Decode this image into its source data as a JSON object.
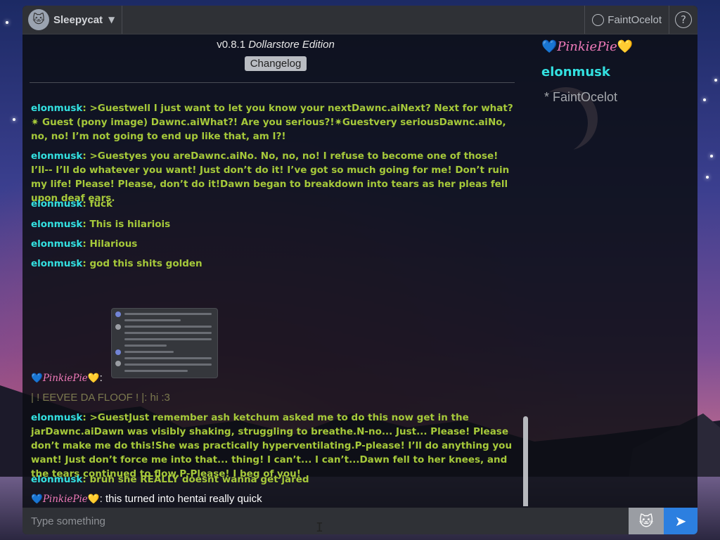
{
  "topbar": {
    "room_name": "Sleepycat",
    "username": "FaintOcelot",
    "help_label": "?"
  },
  "header": {
    "version": "v0.8.1",
    "edition": "Dollarstore Edition",
    "changelog_label": "Changelog"
  },
  "messages": [
    {
      "nick": "elonmusk",
      "text": ": >Guestwell I just want to let you know your nextDawnc.aiNext? Next for what?✷ Guest (pony image) Dawnc.aiWhat?! Are you serious?!✷Guestvery seriousDawnc.aiNo, no, no! I’m not going to end up like that, am I?!"
    },
    {
      "nick": "elonmusk",
      "text": ": >Guestyes you areDawnc.aiNo. No, no, no! I refuse to become one of those! I’ll-- I’ll do whatever you want! Just don’t do it! I’ve got so much going for me! Don’t ruin my life! Please! Please, don’t do it!Dawn began to breakdown into tears as her pleas fell upon deaf ears."
    },
    {
      "nick": "elonmusk",
      "text": ": fuck"
    },
    {
      "nick": "elonmusk",
      "text": ": This is hilariois"
    },
    {
      "nick": "elonmusk",
      "text": ": Hilarious"
    },
    {
      "nick": "elonmusk",
      "text": ": god this shits golden"
    },
    {
      "nick": "PinkiePie",
      "text": ":"
    },
    {
      "nick": "",
      "text": "| ! EEVEE DA FLOOF ! |: hi :3"
    },
    {
      "nick": "elonmusk",
      "text": ": >GuestJust remember ash ketchum asked me to do this now get in the jarDawnc.aiDawn was visibly shaking, struggling to breathe.N-no... Just... Please! Please don’t make me do this!She was practically hyperventilating.P-please! I’ll do anything you want! Just don’t force me into that... thing! I can’t... I can’t...Dawn fell to her knees, and the tears continued to flow.P-Please! I beg of you!"
    },
    {
      "nick": "elonmusk",
      "text": ": bruh she REALLY doesnt wanna get jared"
    },
    {
      "nick": "PinkiePie",
      "text": ": this turned into hentai really quick"
    }
  ],
  "userlist": {
    "pinkie": "PinkiePie",
    "elon": "elonmusk",
    "faint": "* FaintOcelot"
  },
  "input": {
    "placeholder": "Type something"
  },
  "icons": {
    "heart_left": "💙",
    "heart_right": "💛",
    "cat": "🐱",
    "send": "➤"
  },
  "colors": {
    "nick": "#33e0e0",
    "message": "#a6c93a",
    "pinkie": "#f07ab9",
    "send_button": "#2c7fe0"
  }
}
